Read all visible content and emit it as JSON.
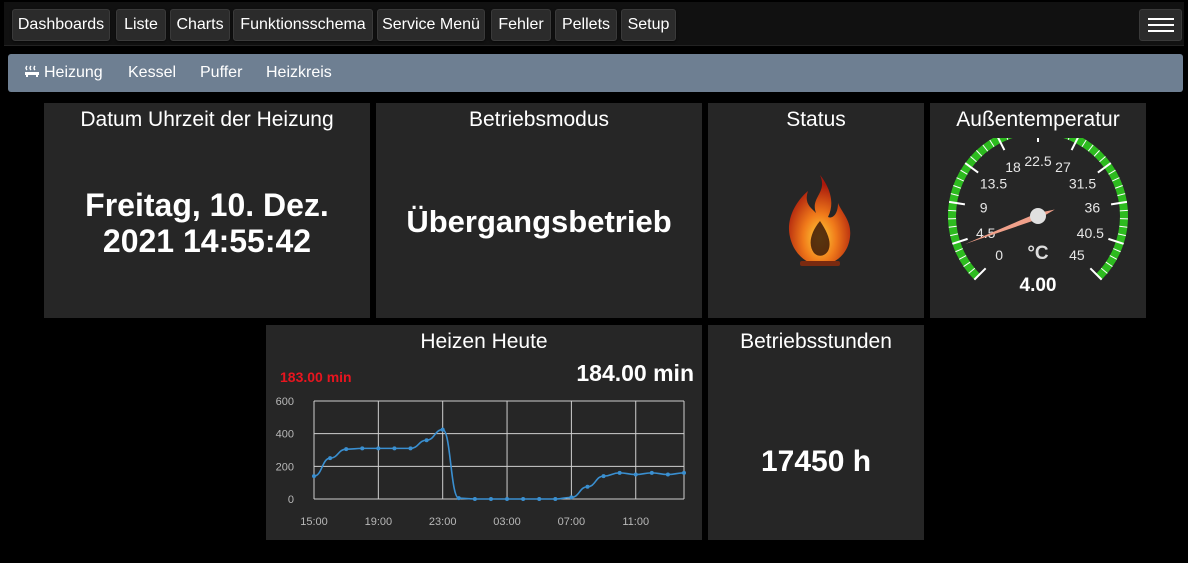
{
  "topnav": {
    "items": [
      "Dashboards",
      "Liste",
      "Charts",
      "Funktionsschema",
      "Service Menü",
      "Fehler",
      "Pellets",
      "Setup"
    ]
  },
  "subnav": {
    "items": [
      "Heizung",
      "Kessel",
      "Puffer",
      "Heizkreis"
    ]
  },
  "panels": {
    "datetime": {
      "title": "Datum Uhrzeit der Heizung",
      "line1": "Freitag, 10. Dez.",
      "line2": "2021 14:55:42"
    },
    "mode": {
      "title": "Betriebsmodus",
      "value": "Übergangsbetrieb"
    },
    "status": {
      "title": "Status",
      "icon": "flame-icon"
    },
    "outdoor": {
      "title": "Außentemperatur",
      "unit": "°C",
      "value": "4.00",
      "numeric_value": 4,
      "scale_labels": [
        "0",
        "4.5",
        "9",
        "13.5",
        "18",
        "22.5",
        "27",
        "31.5",
        "36",
        "40.5",
        "45"
      ],
      "range": [
        0,
        45
      ]
    },
    "heating_today": {
      "title": "Heizen Heute",
      "value": "184.00 min",
      "previous": "183.00 min"
    },
    "hours": {
      "title": "Betriebsstunden",
      "value": "17450 h"
    }
  },
  "colors": {
    "accent_red": "#e8151f",
    "line_blue": "#3a8fd0",
    "gauge_green": "#2dbb1f",
    "subnav_bg": "#6e7f92"
  },
  "chart_data": {
    "type": "line",
    "x": [
      "15:00",
      "16:00",
      "17:00",
      "18:00",
      "19:00",
      "20:00",
      "21:00",
      "22:00",
      "23:00",
      "00:00",
      "01:00",
      "02:00",
      "03:00",
      "04:00",
      "05:00",
      "06:00",
      "07:00",
      "08:00",
      "09:00",
      "10:00",
      "11:00",
      "12:00",
      "13:00",
      "14:00"
    ],
    "x_ticks": [
      "15:00",
      "19:00",
      "23:00",
      "03:00",
      "07:00",
      "11:00"
    ],
    "series": [
      {
        "values": [
          140,
          250,
          305,
          310,
          310,
          310,
          310,
          360,
          425,
          5,
          0,
          0,
          0,
          0,
          0,
          0,
          10,
          75,
          140,
          160,
          150,
          160,
          150,
          160
        ]
      }
    ],
    "ylim": [
      0,
      600
    ],
    "y_ticks": [
      0,
      200,
      400,
      600
    ],
    "grid": true
  }
}
